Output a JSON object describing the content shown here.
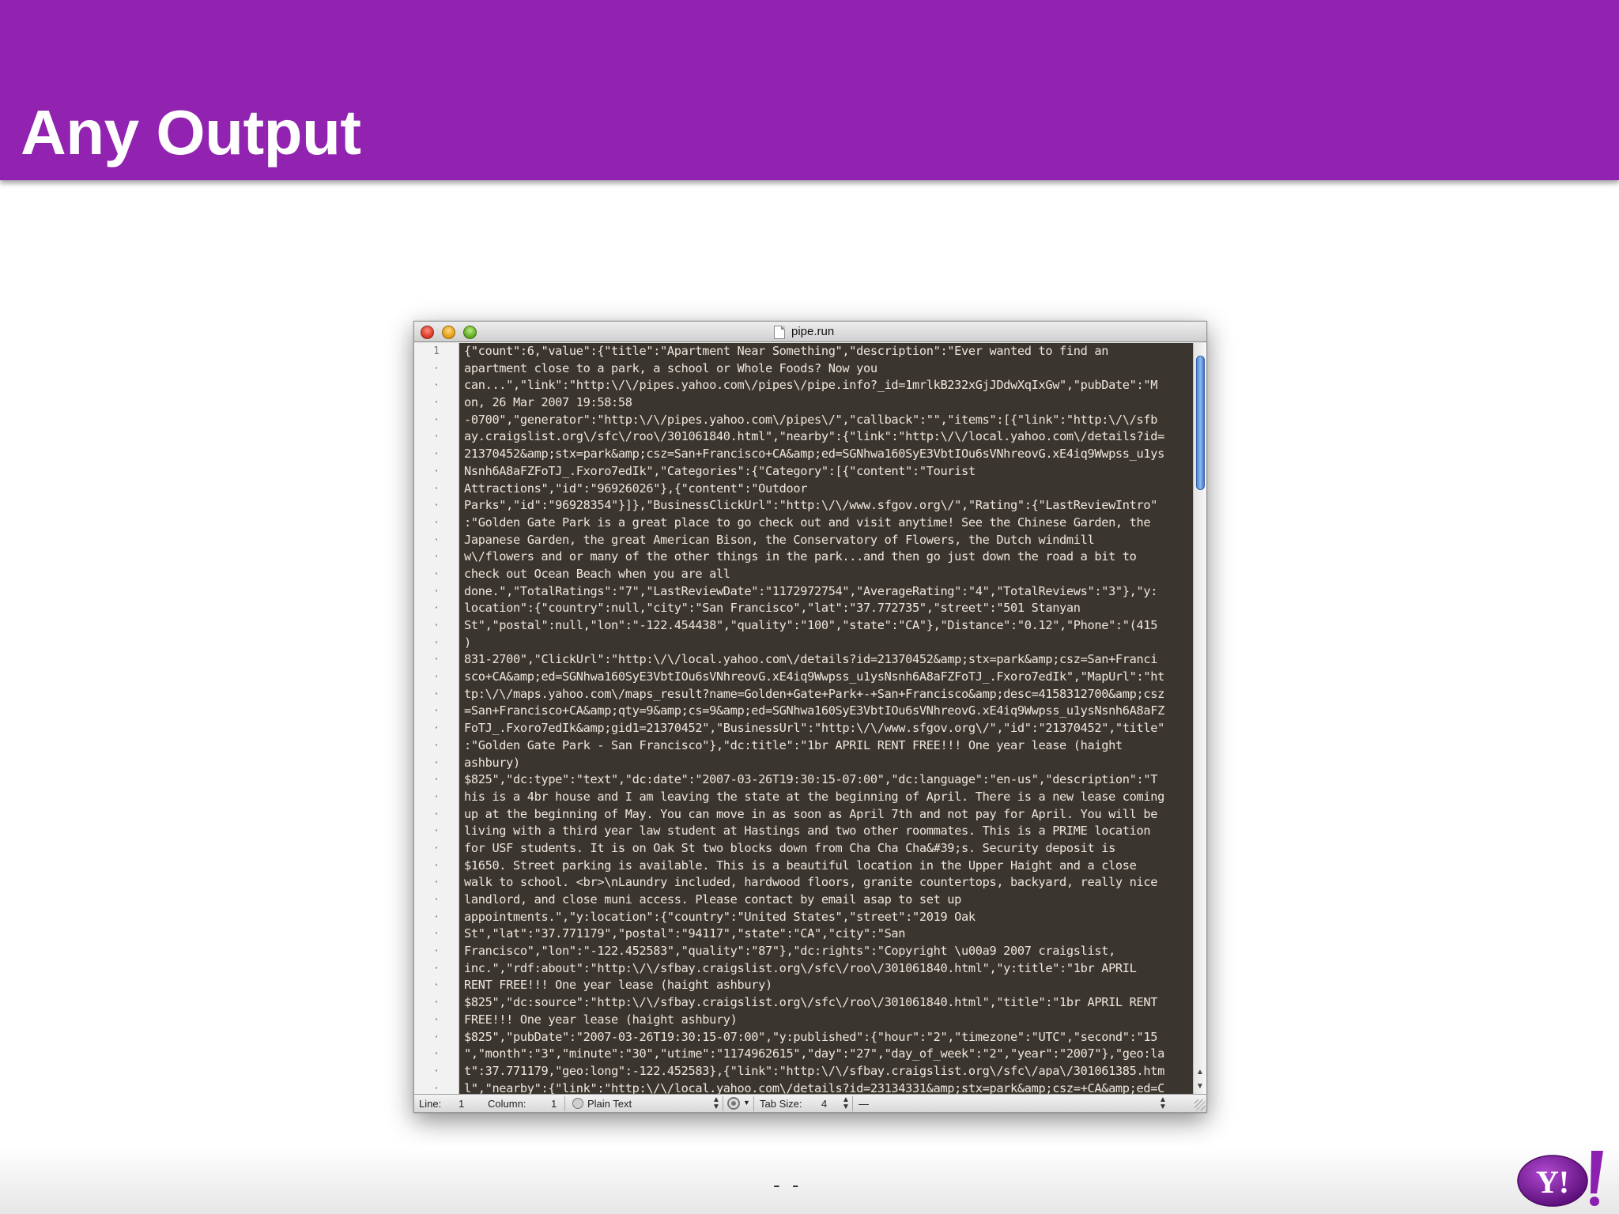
{
  "slide": {
    "title": "Any Output",
    "page_number": "- -",
    "colors": {
      "header": "#9123b0",
      "editor_bg": "#3b3530"
    },
    "logo": {
      "text": "Y!"
    }
  },
  "window": {
    "title": "pipe.run",
    "gutter_first": "1",
    "gutter_marker": "·"
  },
  "editor": {
    "lines": [
      "{\"count\":6,\"value\":{\"title\":\"Apartment Near Something\",\"description\":\"Ever wanted to find an",
      "apartment close to a park, a school or Whole Foods? Now you",
      "can...\",\"link\":\"http:\\/\\/pipes.yahoo.com\\/pipes\\/pipe.info?_id=1mrlkB232xGjJDdwXqIxGw\",\"pubDate\":\"M",
      "on, 26 Mar 2007 19:58:58",
      "-0700\",\"generator\":\"http:\\/\\/pipes.yahoo.com\\/pipes\\/\",\"callback\":\"\",\"items\":[{\"link\":\"http:\\/\\/sfb",
      "ay.craigslist.org\\/sfc\\/roo\\/301061840.html\",\"nearby\":{\"link\":\"http:\\/\\/local.yahoo.com\\/details?id=",
      "21370452&amp;stx=park&amp;csz=San+Francisco+CA&amp;ed=SGNhwa160SyE3VbtIOu6sVNhreovG.xE4iq9Wwpss_u1ys",
      "Nsnh6A8aFZFoTJ_.Fxoro7edIk\",\"Categories\":{\"Category\":[{\"content\":\"Tourist",
      "Attractions\",\"id\":\"96926026\"},{\"content\":\"Outdoor",
      "Parks\",\"id\":\"96928354\"}]},\"BusinessClickUrl\":\"http:\\/\\/www.sfgov.org\\/\",\"Rating\":{\"LastReviewIntro\"",
      ":\"Golden Gate Park is a great place to go check out and visit anytime! See the Chinese Garden, the",
      "Japanese Garden, the great American Bison, the Conservatory of Flowers, the Dutch windmill",
      "w\\/flowers and or many of the other things in the park...and then go just down the road a bit to",
      "check out Ocean Beach when you are all",
      "done.\",\"TotalRatings\":\"7\",\"LastReviewDate\":\"1172972754\",\"AverageRating\":\"4\",\"TotalReviews\":\"3\"},\"y:",
      "location\":{\"country\":null,\"city\":\"San Francisco\",\"lat\":\"37.772735\",\"street\":\"501 Stanyan",
      "St\",\"postal\":null,\"lon\":\"-122.454438\",\"quality\":\"100\",\"state\":\"CA\"},\"Distance\":\"0.12\",\"Phone\":\"(415",
      ")",
      "831-2700\",\"ClickUrl\":\"http:\\/\\/local.yahoo.com\\/details?id=21370452&amp;stx=park&amp;csz=San+Franci",
      "sco+CA&amp;ed=SGNhwa160SyE3VbtIOu6sVNhreovG.xE4iq9Wwpss_u1ysNsnh6A8aFZFoTJ_.Fxoro7edIk\",\"MapUrl\":\"ht",
      "tp:\\/\\/maps.yahoo.com\\/maps_result?name=Golden+Gate+Park+-+San+Francisco&amp;desc=4158312700&amp;csz",
      "=San+Francisco+CA&amp;qty=9&amp;cs=9&amp;ed=SGNhwa160SyE3VbtIOu6sVNhreovG.xE4iq9Wwpss_u1ysNsnh6A8aFZ",
      "FoTJ_.Fxoro7edIk&amp;gid1=21370452\",\"BusinessUrl\":\"http:\\/\\/www.sfgov.org\\/\",\"id\":\"21370452\",\"title\"",
      ":\"Golden Gate Park - San Francisco\"},\"dc:title\":\"1br APRIL RENT FREE!!! One year lease (haight",
      "ashbury)",
      "$825\",\"dc:type\":\"text\",\"dc:date\":\"2007-03-26T19:30:15-07:00\",\"dc:language\":\"en-us\",\"description\":\"T",
      "his is a 4br house and I am leaving the state at the beginning of April. There is a new lease coming",
      "up at the beginning of May. You can move in as soon as April 7th and not pay for April. You will be",
      "living with a third year law student at Hastings and two other roommates. This is a PRIME location",
      "for USF students. It is on Oak St two blocks down from Cha Cha Cha&#39;s. Security deposit is",
      "$1650. Street parking is available. This is a beautiful location in the Upper Haight and a close",
      "walk to school. <br>\\nLaundry included, hardwood floors, granite countertops, backyard, really nice",
      "landlord, and close muni access. Please contact by email asap to set up",
      "appointments.\",\"y:location\":{\"country\":\"United States\",\"street\":\"2019 Oak",
      "St\",\"lat\":\"37.771179\",\"postal\":\"94117\",\"state\":\"CA\",\"city\":\"San",
      "Francisco\",\"lon\":\"-122.452583\",\"quality\":\"87\"},\"dc:rights\":\"Copyright \\u00a9 2007 craigslist,",
      "inc.\",\"rdf:about\":\"http:\\/\\/sfbay.craigslist.org\\/sfc\\/roo\\/301061840.html\",\"y:title\":\"1br APRIL",
      "RENT FREE!!! One year lease (haight ashbury)",
      "$825\",\"dc:source\":\"http:\\/\\/sfbay.craigslist.org\\/sfc\\/roo\\/301061840.html\",\"title\":\"1br APRIL RENT",
      "FREE!!! One year lease (haight ashbury)",
      "$825\",\"pubDate\":\"2007-03-26T19:30:15-07:00\",\"y:published\":{\"hour\":\"2\",\"timezone\":\"UTC\",\"second\":\"15",
      "\",\"month\":\"3\",\"minute\":\"30\",\"utime\":\"1174962615\",\"day\":\"27\",\"day_of_week\":\"2\",\"year\":\"2007\"},\"geo:la",
      "t\":37.771179,\"geo:long\":-122.452583},{\"link\":\"http:\\/\\/sfbay.craigslist.org\\/sfc\\/apa\\/301061385.htm",
      "l\",\"nearby\":{\"link\":\"http:\\/\\/local.yahoo.com\\/details?id=23134331&amp;stx=park&amp;csz=+CA&amp;ed=C"
    ]
  },
  "statusbar": {
    "line_label": "Line:",
    "line_value": "1",
    "column_label": "Column:",
    "column_value": "1",
    "syntax": "Plain Text",
    "tab_size_label": "Tab Size:",
    "tab_size_value": "4",
    "symbol": "—"
  }
}
